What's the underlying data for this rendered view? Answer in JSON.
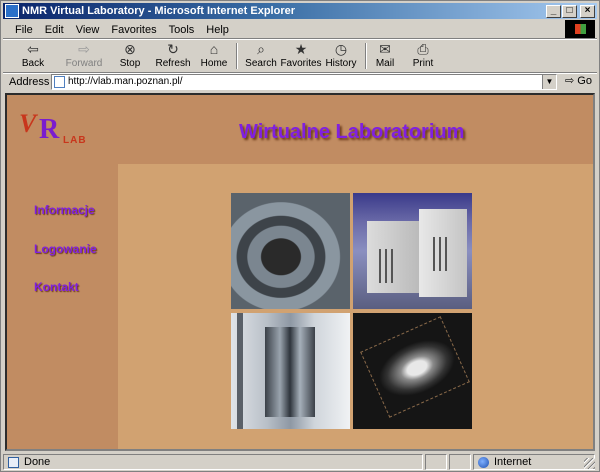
{
  "window": {
    "title": "NMR Virtual Laboratory - Microsoft Internet Explorer",
    "controls": {
      "minimize": "_",
      "maximize": "□",
      "close": "×"
    }
  },
  "menu": [
    "File",
    "Edit",
    "View",
    "Favorites",
    "Tools",
    "Help"
  ],
  "toolbar": [
    {
      "label": "Back",
      "icon": "back-arrow-icon",
      "glyph": "⇦",
      "enabled": true
    },
    {
      "label": "Forward",
      "icon": "forward-arrow-icon",
      "glyph": "⇨",
      "enabled": false
    },
    {
      "label": "Stop",
      "icon": "stop-icon",
      "glyph": "⊗",
      "enabled": true
    },
    {
      "label": "Refresh",
      "icon": "refresh-icon",
      "glyph": "↻",
      "enabled": true
    },
    {
      "label": "Home",
      "icon": "home-icon",
      "glyph": "⌂",
      "enabled": true
    },
    {
      "label": "Search",
      "icon": "search-icon",
      "glyph": "⌕",
      "enabled": true
    },
    {
      "label": "Favorites",
      "icon": "favorites-icon",
      "glyph": "★",
      "enabled": true
    },
    {
      "label": "History",
      "icon": "history-icon",
      "glyph": "◷",
      "enabled": true
    },
    {
      "label": "Mail",
      "icon": "mail-icon",
      "glyph": "✉",
      "enabled": true
    },
    {
      "label": "Print",
      "icon": "print-icon",
      "glyph": "⎙",
      "enabled": true
    }
  ],
  "address": {
    "label": "Address",
    "url": "http://vlab.man.poznan.pl/",
    "go_label": "Go"
  },
  "page": {
    "logo": {
      "w": "V",
      "r": "R",
      "lab": "LAB"
    },
    "title": "Wirtualne Laboratorium",
    "nav": [
      "Informacje",
      "Logowanie",
      "Kontakt"
    ],
    "colors": {
      "background": "#c18c62",
      "panel": "#d1a271",
      "link": "#8020e0"
    }
  },
  "status": {
    "text": "Done",
    "zone": "Internet"
  }
}
